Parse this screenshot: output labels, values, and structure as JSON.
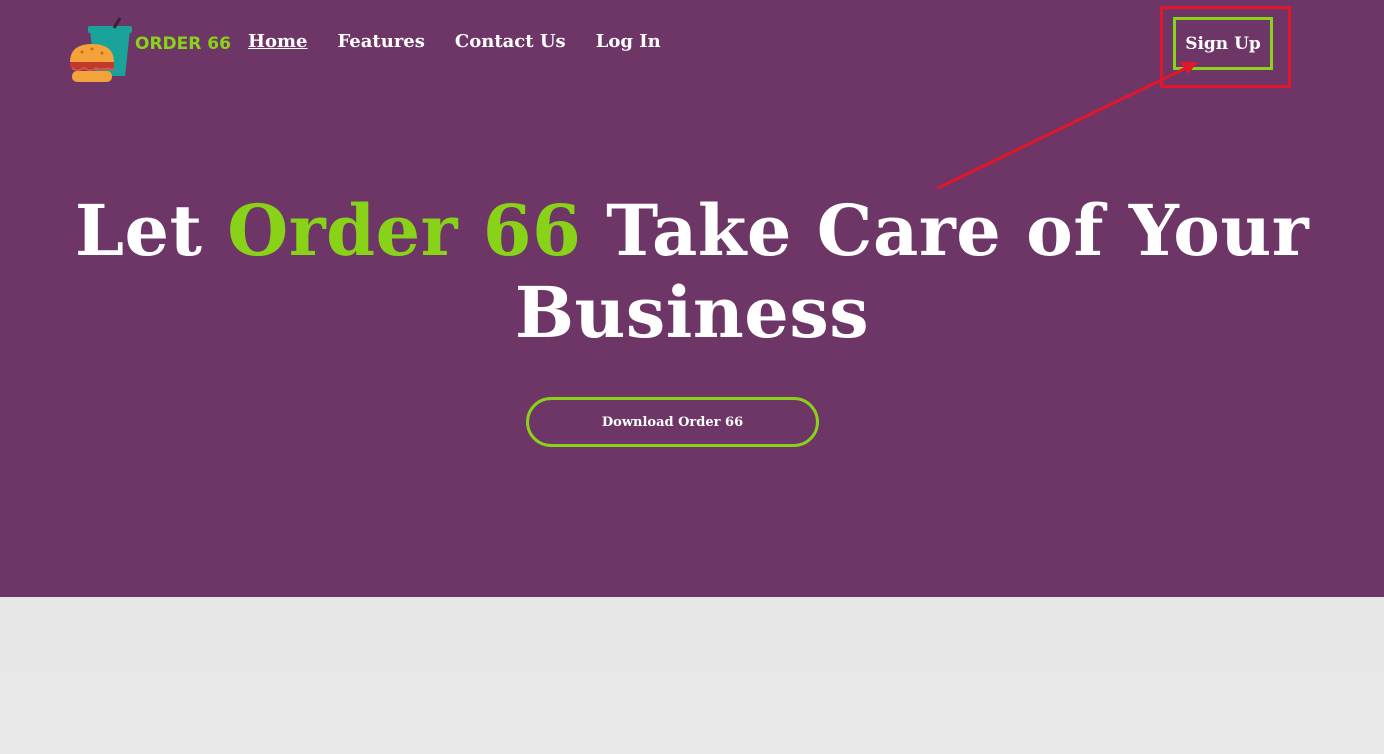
{
  "brand": {
    "name": "ORDER 66",
    "accent_color": "#88d317",
    "hero_bg_color": "#6e3667"
  },
  "nav": {
    "items": [
      {
        "label": "Home",
        "active": true
      },
      {
        "label": "Features",
        "active": false
      },
      {
        "label": "Contact Us",
        "active": false
      },
      {
        "label": "Log In",
        "active": false
      }
    ],
    "signup_label": "Sign Up"
  },
  "hero": {
    "headline_pre": "Let ",
    "headline_accent": "Order 66",
    "headline_post_line1": " Take Care of Your",
    "headline_line2": "Business",
    "cta_label": "Download Order 66"
  },
  "annotation": {
    "color": "#e0162b",
    "target": "signup-button"
  }
}
